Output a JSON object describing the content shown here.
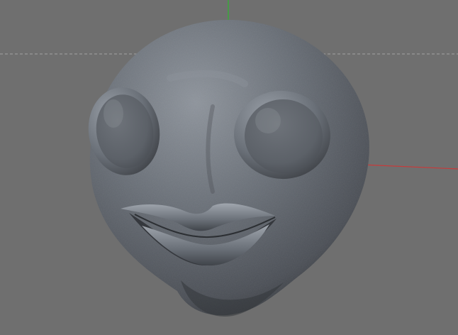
{
  "viewport": {
    "background_color": "#6f6f6f",
    "grid_line_color": "#a3a3a3",
    "y_axis_color": "#3aa83a",
    "x_axis_color": "#c83a3a"
  },
  "model": {
    "shape": "sculpted head with two large round eyes and an open mouth",
    "surface_color": "#5b6068",
    "highlight_color": "#9aa0a8",
    "shadow_color": "#2e3136"
  }
}
